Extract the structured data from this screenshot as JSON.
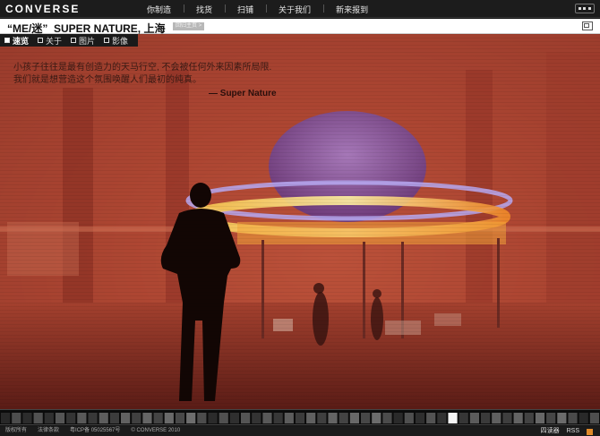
{
  "header": {
    "logo": "CONVERSE",
    "nav": [
      "你制造",
      "找货",
      "扫铺",
      "关于我们",
      "新来报到"
    ]
  },
  "title": {
    "text": "“ME/迷”  SUPER NATURE, 上海",
    "badge": "回归主页 >"
  },
  "tabs": [
    {
      "label": "速览",
      "active": true
    },
    {
      "label": "关于",
      "active": false
    },
    {
      "label": "图片",
      "active": false
    },
    {
      "label": "影像",
      "active": false
    }
  ],
  "caption": {
    "line1": "小孩子往往是最有创造力的天马行空, 不会被任何外来因素所局限.",
    "line2": "我们就是想营造这个氛围唤醒人们最初的纯真。",
    "signature": "— Super Nature"
  },
  "filmstrip": {
    "selected_index": 41,
    "frames": 55
  },
  "footer": {
    "copyright": "版权所有",
    "legal": "法律条款",
    "icp": "粤ICP备 05025567号",
    "brand": "© CONVERSE 2010",
    "read": "四读器",
    "rss": "RSS"
  }
}
